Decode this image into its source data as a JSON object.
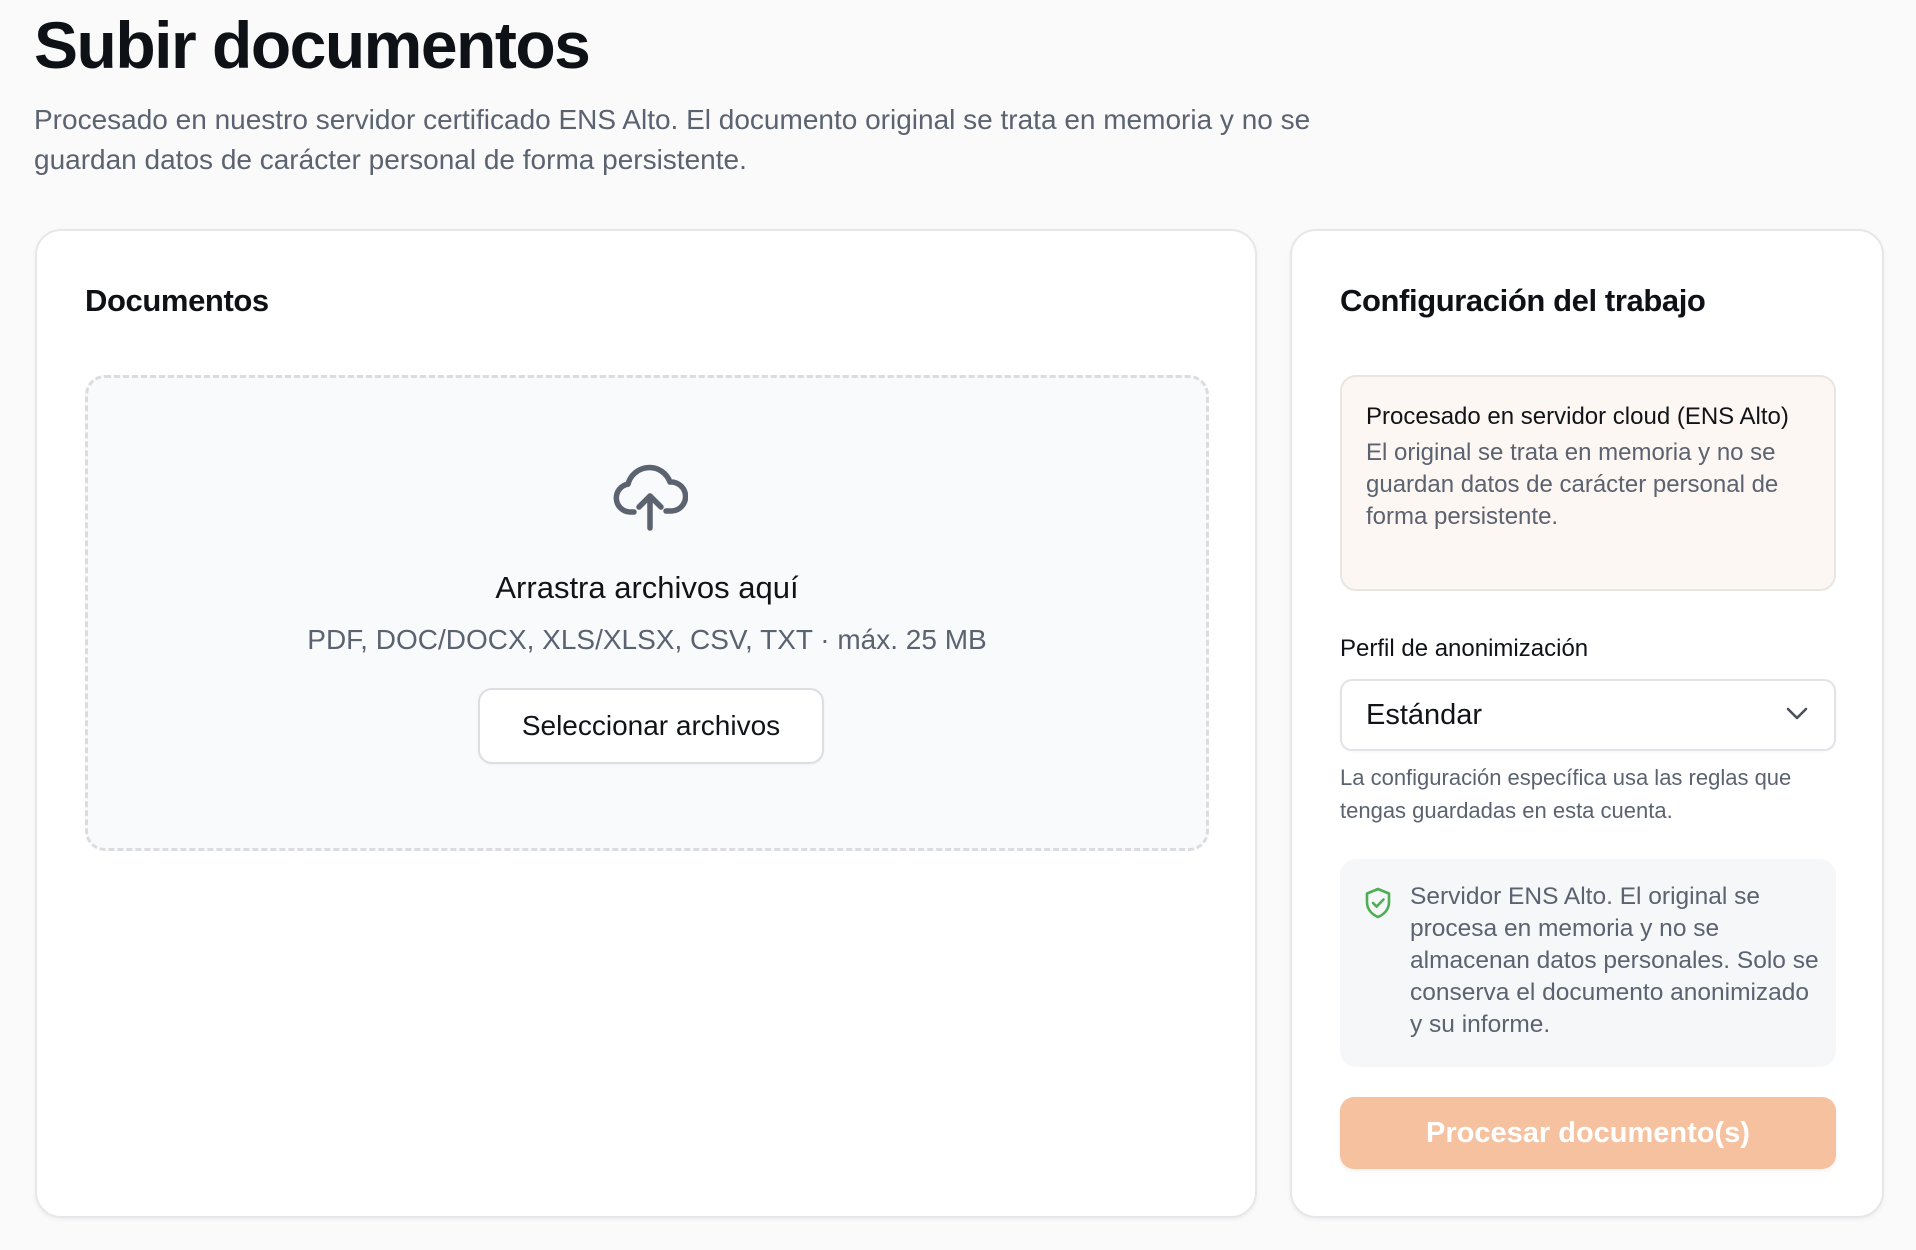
{
  "header": {
    "title": "Subir documentos",
    "subtitle": "Procesado en nuestro servidor certificado ENS Alto. El documento original se trata en memoria y no se guardan datos de carácter personal de forma persistente."
  },
  "documents_card": {
    "title": "Documentos",
    "dropzone": {
      "icon": "cloud-upload-icon",
      "title": "Arrastra archivos aquí",
      "hint": "PDF, DOC/DOCX, XLS/XLSX, CSV, TXT · máx. 25 MB",
      "button_label": "Seleccionar archivos"
    }
  },
  "config_card": {
    "title": "Configuración del trabajo",
    "notice": {
      "title": "Procesado en servidor cloud (ENS Alto)",
      "body": "El original se trata en memoria y no se guardan datos de carácter personal de forma persistente."
    },
    "profile": {
      "label": "Perfil de anonimización",
      "selected": "Estándar",
      "help": "La configuración específica usa las reglas que tengas guardadas en esta cuenta."
    },
    "info": {
      "icon": "shield-check-icon",
      "text": "Servidor ENS Alto. El original se procesa en memoria y no se almacenan datos personales. Solo se conserva el documento anonimizado y su informe."
    },
    "process_button": {
      "label": "Procesar documento(s)",
      "disabled": true
    }
  },
  "colors": {
    "accent_disabled": "#f5c19f",
    "notice_background": "#fdf7f3",
    "shield_green": "#4caf50",
    "muted_text": "#5b6270"
  }
}
